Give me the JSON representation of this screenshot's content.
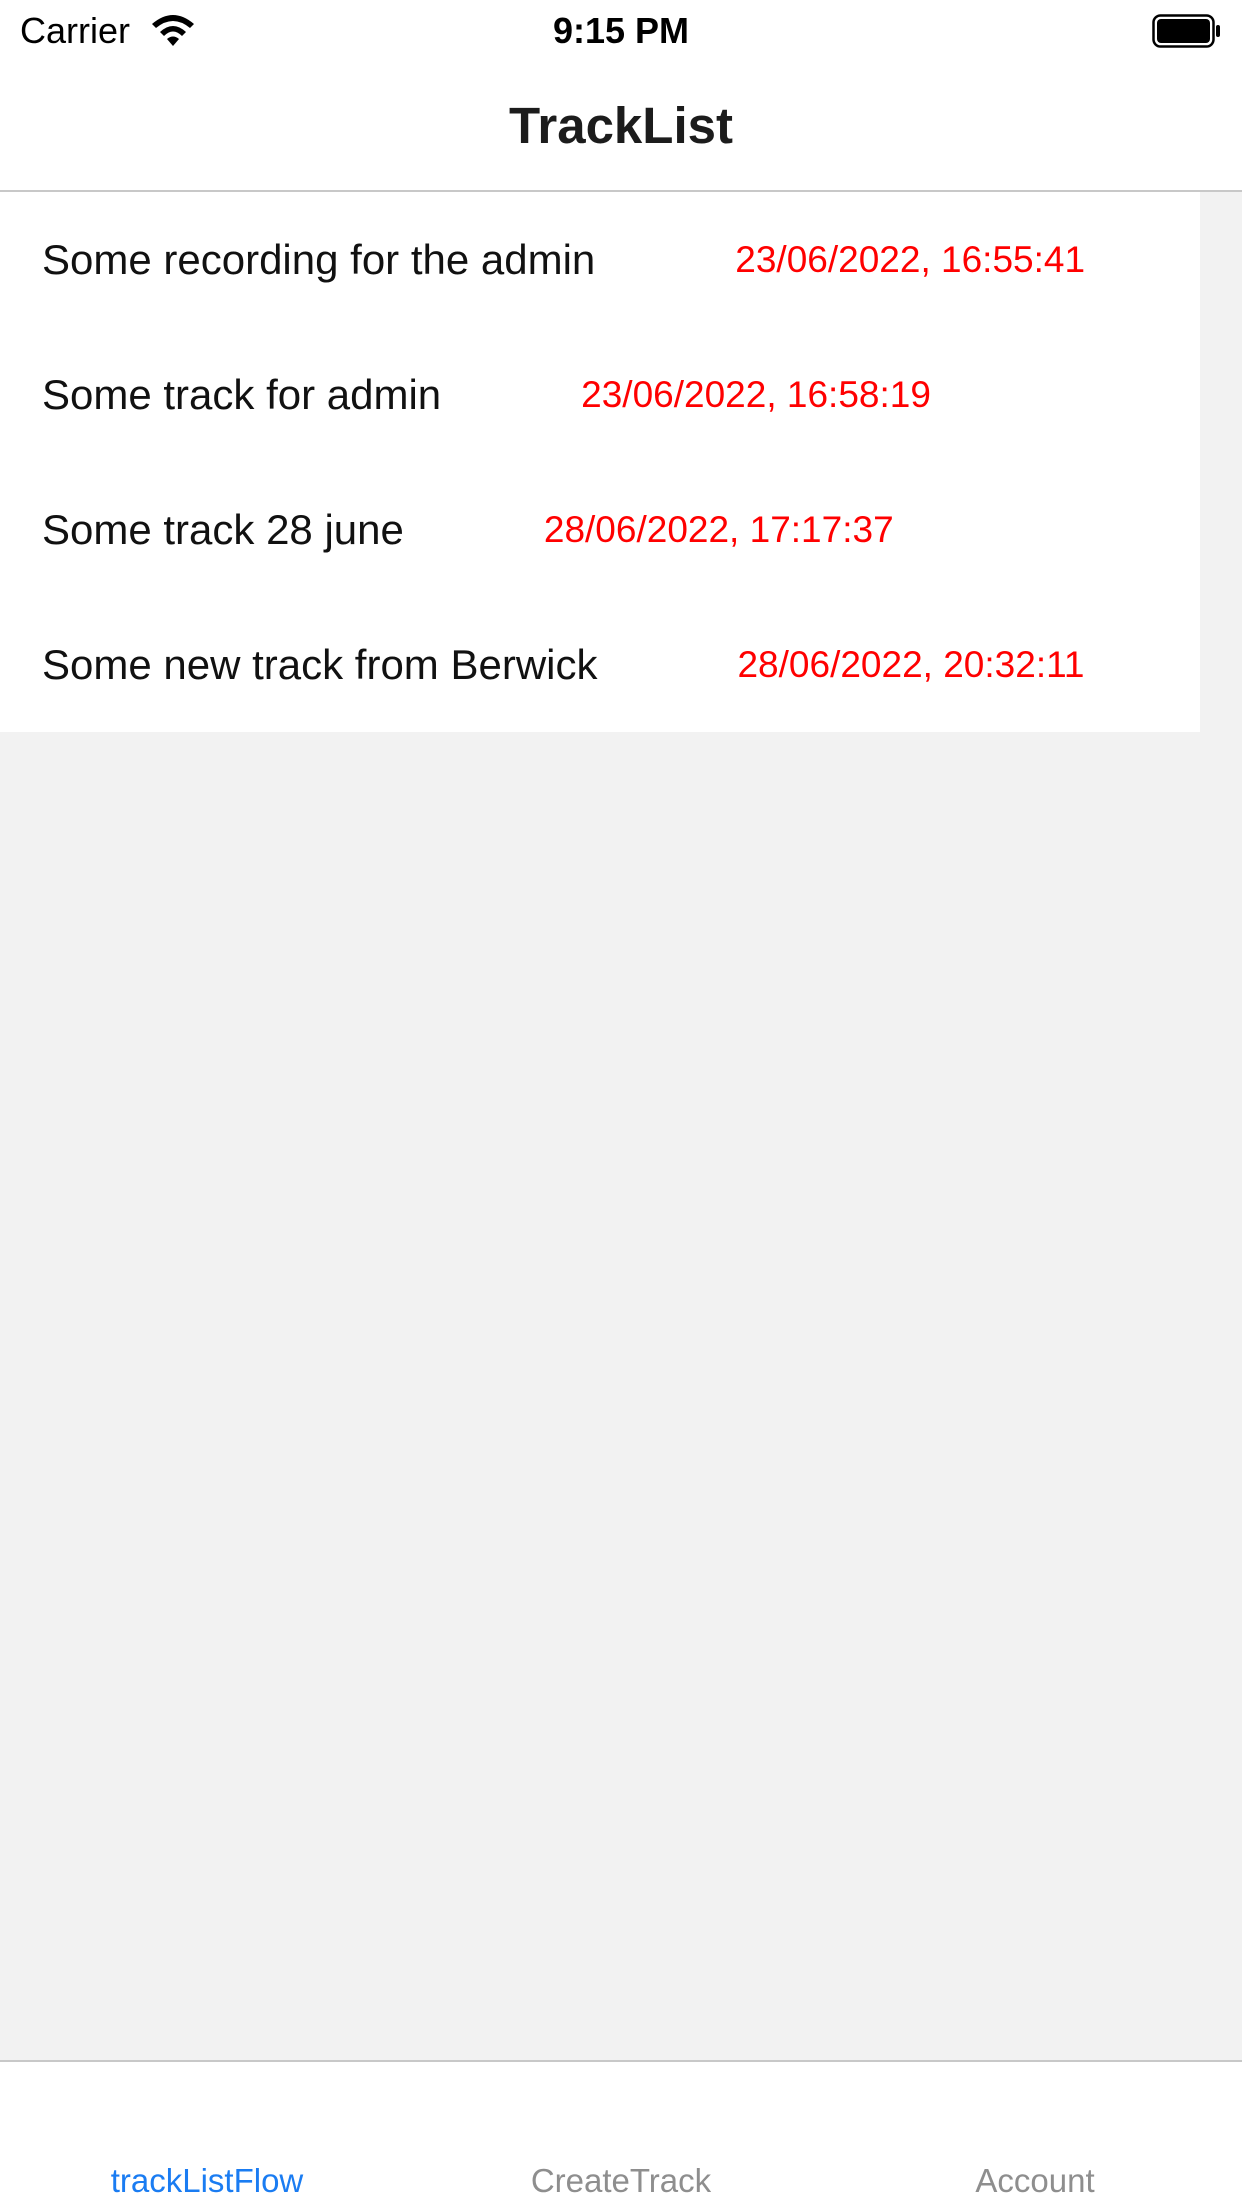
{
  "status_bar": {
    "carrier": "Carrier",
    "time": "9:15 PM",
    "wifi_icon": "wifi-icon",
    "battery_icon": "battery-icon"
  },
  "nav": {
    "title": "TrackList"
  },
  "tracks": [
    {
      "title": "Some recording for the admin",
      "date": "23/06/2022, 16:55:41"
    },
    {
      "title": "Some track for admin",
      "date": "23/06/2022, 16:58:19"
    },
    {
      "title": "Some track 28 june",
      "date": "28/06/2022, 17:17:37"
    },
    {
      "title": "Some new track from Berwick",
      "date": "28/06/2022, 20:32:11"
    }
  ],
  "tab_bar": {
    "tabs": [
      {
        "label": "trackListFlow",
        "active": true
      },
      {
        "label": "CreateTrack",
        "active": false
      },
      {
        "label": "Account",
        "active": false
      }
    ]
  },
  "colors": {
    "accent": "#1a7cf2",
    "date_text": "#ff0000",
    "inactive_tab": "#8e8e8e",
    "background": "#f2f2f2"
  }
}
